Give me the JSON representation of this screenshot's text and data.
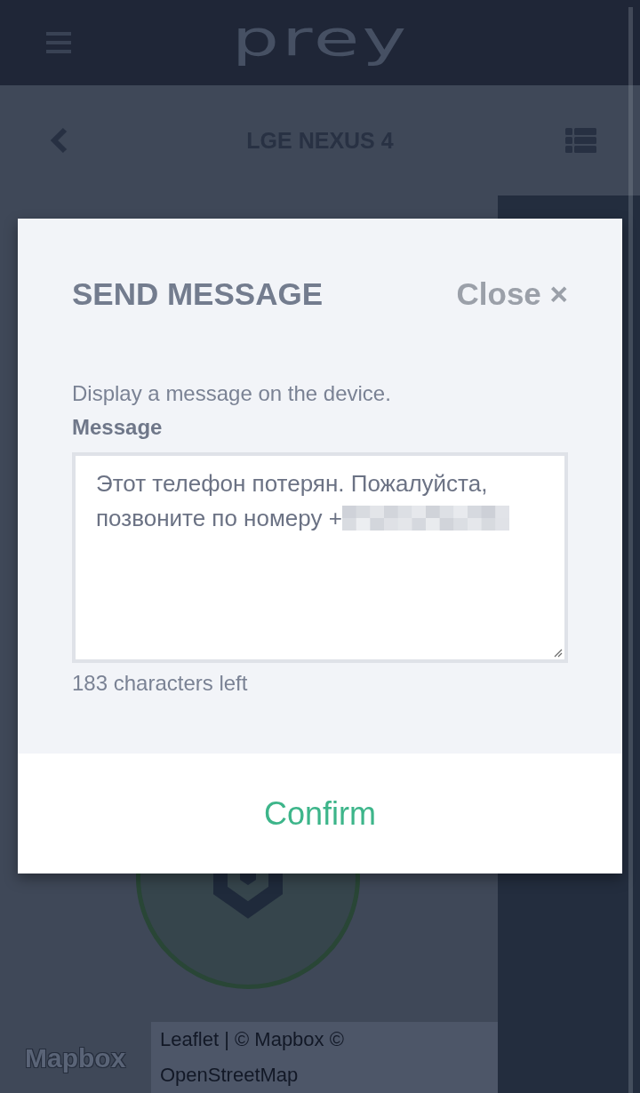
{
  "header": {
    "logo_text": "prey"
  },
  "device_bar": {
    "title": "LGE NEXUS 4"
  },
  "map": {
    "logo_text": "Mapbox",
    "attribution": "Leaflet | © Mapbox © OpenStreetMap"
  },
  "modal": {
    "title": "SEND MESSAGE",
    "close": "Close ×",
    "description": "Display a message on the device.",
    "field_label": "Message",
    "message": {
      "value": "Этот телефон потерян. Пожалуйста, позвоните по номеру +",
      "redacted": true
    },
    "counter": "183 characters left",
    "confirm": "Confirm"
  }
}
